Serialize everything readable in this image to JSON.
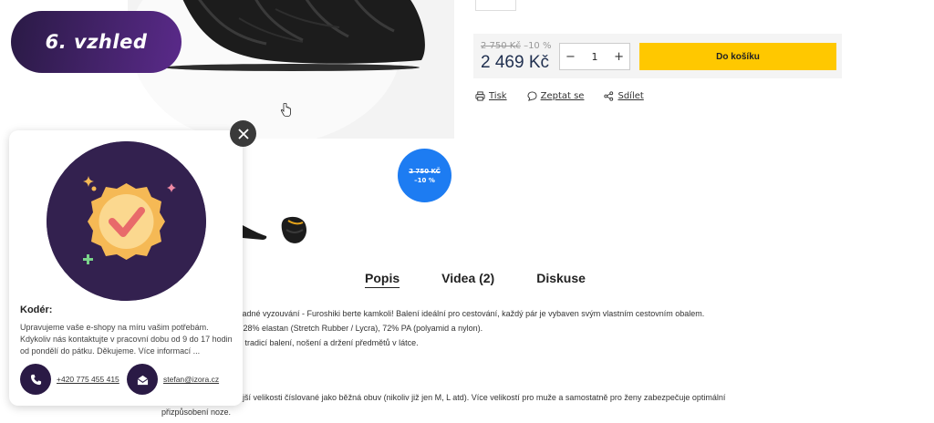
{
  "step_badge": {
    "label": "6. vzhled"
  },
  "product": {
    "old_price": "2 750 Kč",
    "discount": "–10 %",
    "price": "2 469 Kč",
    "quantity": "1",
    "add_to_cart": "Do košíku"
  },
  "actions": [
    {
      "label": "Tisk",
      "icon": "print-icon"
    },
    {
      "label": "Zeptat se",
      "icon": "chat-icon"
    },
    {
      "label": "Sdílet",
      "icon": "share-icon"
    }
  ],
  "discount_badge": {
    "old_price": "2 750 KČ",
    "discount": "–10 %"
  },
  "tabs": [
    {
      "label": "Popis",
      "active": true
    },
    {
      "label": "Videa (2)"
    },
    {
      "label": "Diskuse"
    }
  ],
  "description": {
    "line1": "snadné vyzouvání - Furoshiki berte kamkoli! Balení ideální pro cestování, každý pár je vybaven svým vlastním cestovním obalem.",
    "line2_bold": "e:",
    "line2": "28% elastan (Stretch Rubber / Lycra), 72% PA (polyamid a nylon).",
    "line3": "ou tradicí balení, nošení a držení předmětů v látce.",
    "line4": "nější velikosti číslované jako běžná obuv (nikoliv již jen M, L atd). Více velikostí pro muže a samostatně pro ženy zabezpečuje optimální",
    "line5": "přizpůsobení noze."
  },
  "popup": {
    "heading": "Kodér:",
    "text": "Upravujeme vaše e-shopy na míru vašim potřebám. Kdykoliv nás kontaktujte v pracovní dobu od 9 do 17 hodin od pondělí do pátku. Děkujeme. Více informací ...",
    "phone": "+420 775 455 415",
    "email": "stefan@izora.cz"
  },
  "colors": {
    "accent_yellow": "#ffc800",
    "badge_purple": "#2a1a45",
    "discount_blue": "#1d7cf2",
    "price_navy": "#1f2f4f"
  }
}
